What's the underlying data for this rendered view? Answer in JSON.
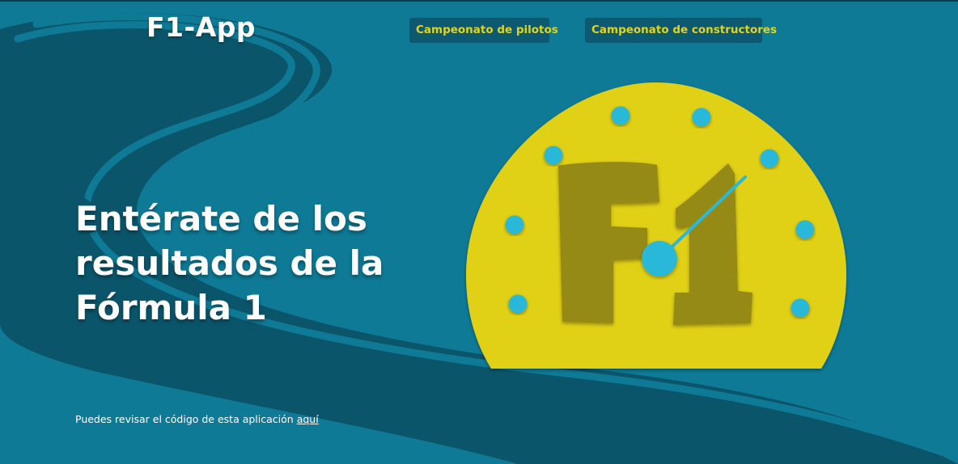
{
  "header": {
    "brand": "F1-App",
    "nav": {
      "pilots_label": "Campeonato de pilotos",
      "constructors_label": "Campeonato de constructores"
    }
  },
  "hero": {
    "title_line1": "Entérate de los",
    "title_line2": "resultados de la",
    "title_line3": "Fórmula 1"
  },
  "illustration": {
    "logo_text": "F1",
    "icon": "speedometer-f1-icon"
  },
  "footer": {
    "note_text": "Puedes revisar el código de esta aplicación",
    "link_text": "aquí"
  },
  "colors": {
    "background": "#0e7a96",
    "road": "#0b556b",
    "accent_yellow": "#e0d016",
    "logo_olive": "#968a12",
    "dial_dot": "#2cb8d8",
    "nav_button_bg": "#0d5a70"
  }
}
